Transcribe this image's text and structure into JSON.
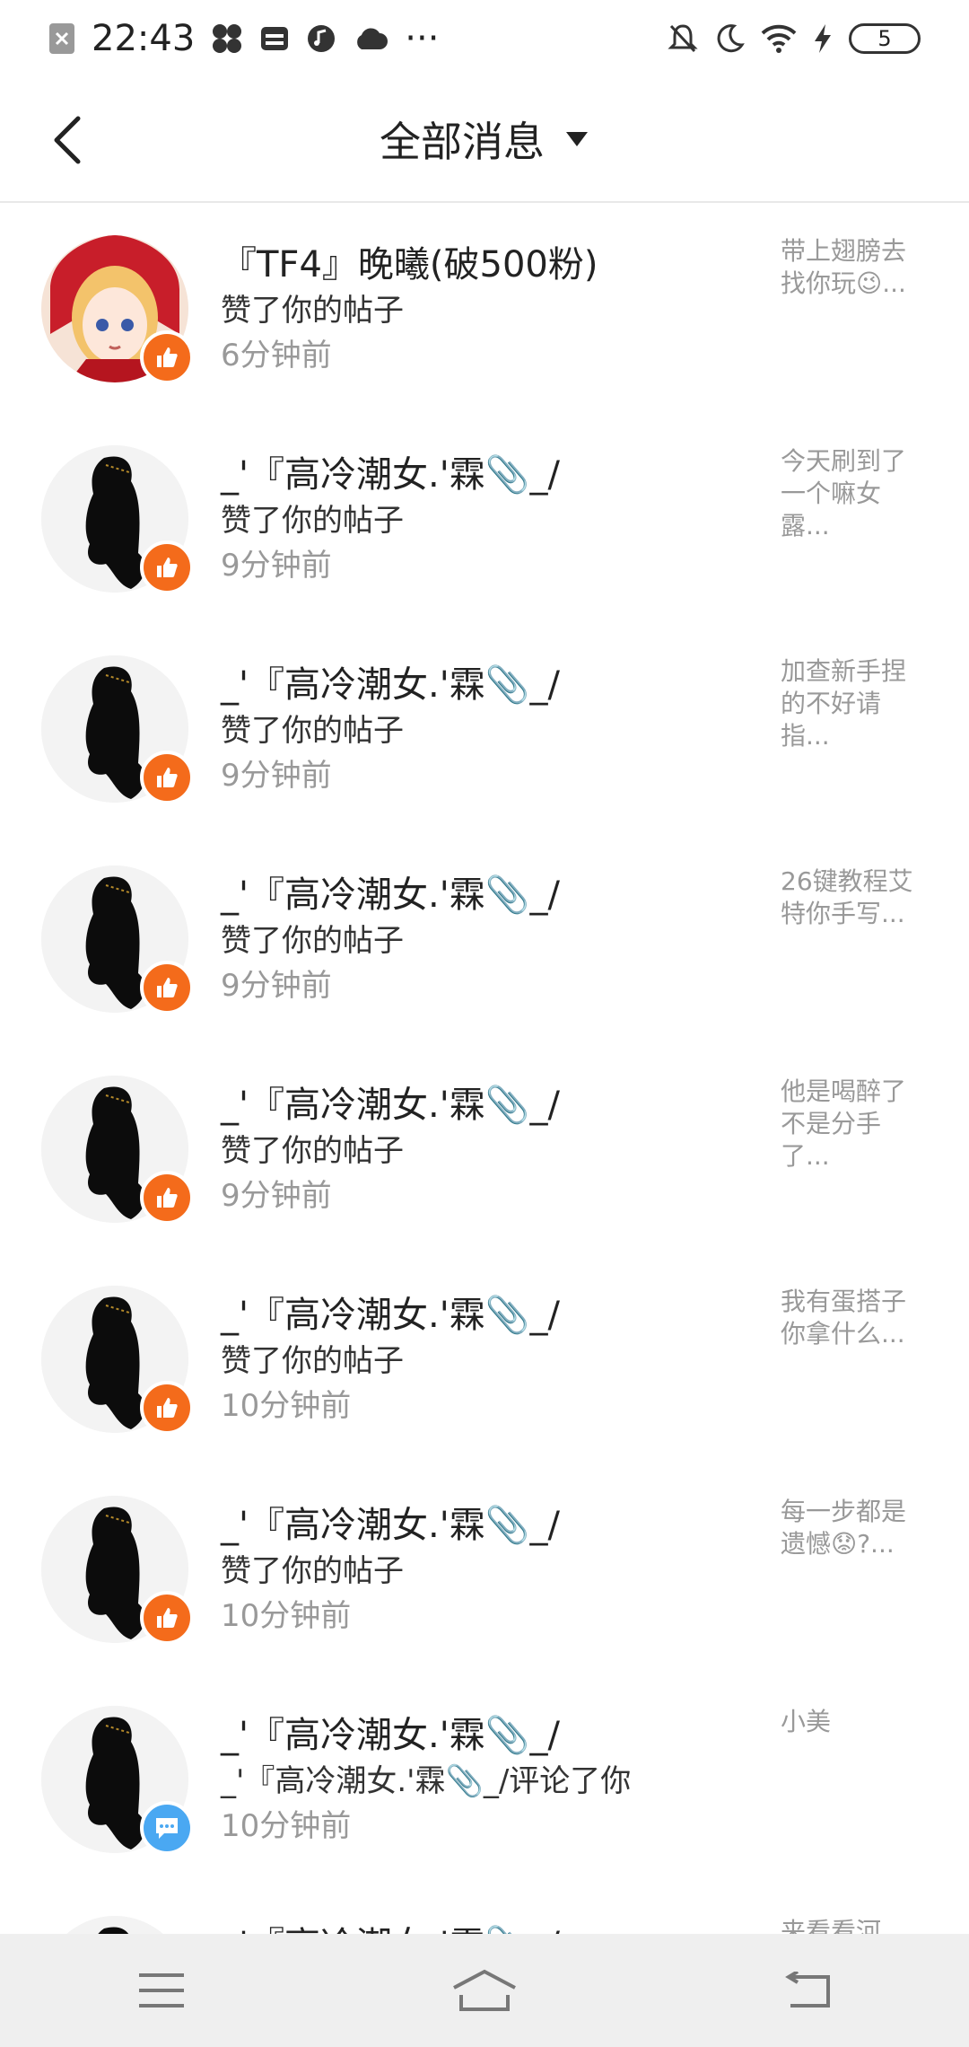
{
  "status_bar": {
    "time": "22:43",
    "battery": "5",
    "more": "···",
    "left_icons": [
      "close-box-icon",
      "pinwheel-icon",
      "wallet-icon",
      "music-icon",
      "cloud-icon"
    ],
    "right_icons": [
      "mute-icon",
      "moon-icon",
      "wifi-icon",
      "charging-icon"
    ]
  },
  "header": {
    "title": "全部消息",
    "dropdown_icon": "caret-down-icon",
    "back_icon": "chevron-left-icon"
  },
  "messages": [
    {
      "name": "『TF4』晚曦(破500粉)",
      "action": "赞了你的帖子",
      "time": "6分钟前",
      "preview": "带上翅膀去\n找你玩😉...",
      "badge": "like"
    },
    {
      "name": "_'『高冷潮女.'霖📎_/",
      "action": "赞了你的帖子",
      "time": "9分钟前",
      "preview": "今天刷到了\n一个嘛女\n露...",
      "badge": "like"
    },
    {
      "name": "_'『高冷潮女.'霖📎_/",
      "action": "赞了你的帖子",
      "time": "9分钟前",
      "preview": "加查新手捏\n的不好请\n指...",
      "badge": "like"
    },
    {
      "name": "_'『高冷潮女.'霖📎_/",
      "action": "赞了你的帖子",
      "time": "9分钟前",
      "preview": "26键教程艾\n特你手写...",
      "badge": "like"
    },
    {
      "name": "_'『高冷潮女.'霖📎_/",
      "action": "赞了你的帖子",
      "time": "9分钟前",
      "preview": "他是喝醉了\n不是分手\n了...",
      "badge": "like"
    },
    {
      "name": "_'『高冷潮女.'霖📎_/",
      "action": "赞了你的帖子",
      "time": "10分钟前",
      "preview": "我有蛋搭子\n你拿什么...",
      "badge": "like"
    },
    {
      "name": "_'『高冷潮女.'霖📎_/",
      "action": "赞了你的帖子",
      "time": "10分钟前",
      "preview": "每一步都是\n遗憾😟?...",
      "badge": "like"
    },
    {
      "name": "_'『高冷潮女.'霖📎_/",
      "action": "_'『高冷潮女.'霖📎_/评论了你",
      "time": "10分钟前",
      "preview": "小美",
      "badge": "comment"
    },
    {
      "name": "_'『高冷潮女.'霖📎_/",
      "action": "",
      "time": "",
      "preview": "来看看河",
      "badge": "like"
    }
  ],
  "nav": {
    "menu_icon": "menu-icon",
    "home_icon": "home-icon",
    "back_icon": "back-arrow-icon"
  },
  "colors": {
    "like_badge": "#f46b1b",
    "comment_badge": "#4aa8f2",
    "muted_text": "#999999",
    "navbar_bg": "#efefef"
  }
}
